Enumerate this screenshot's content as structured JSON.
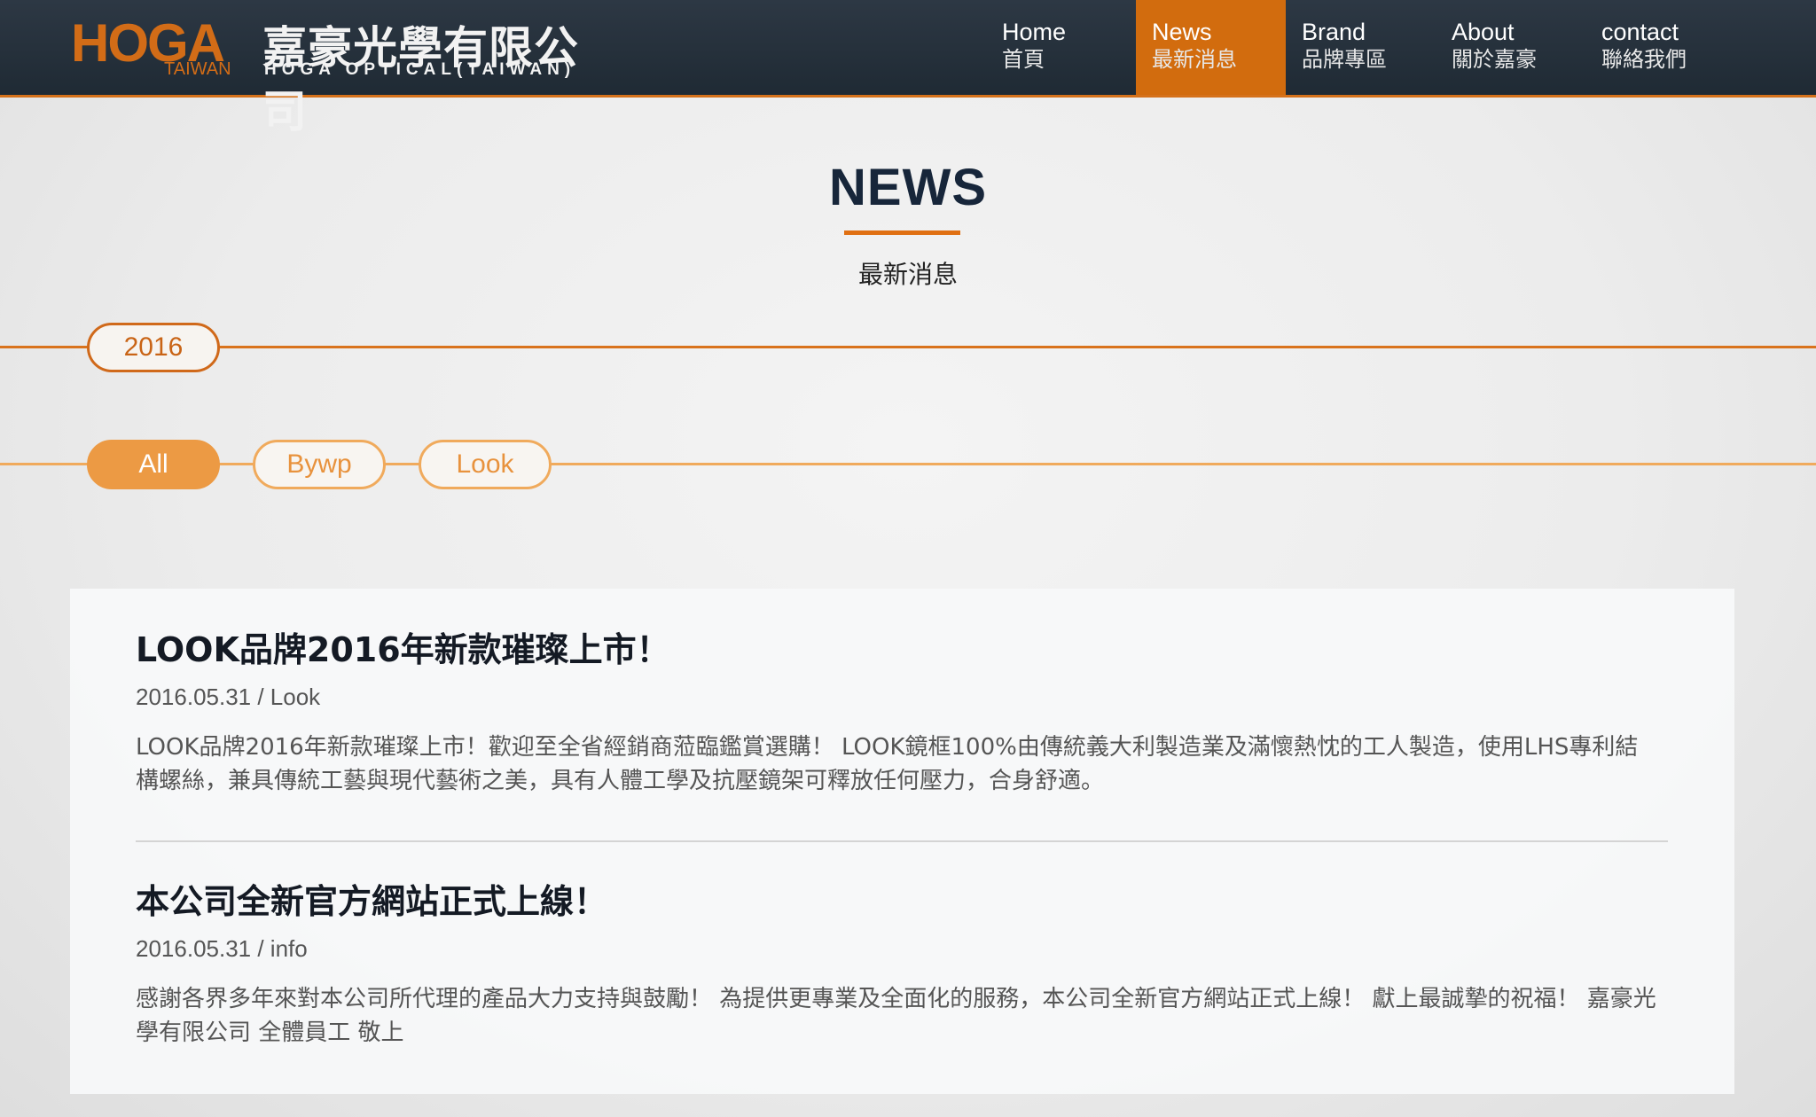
{
  "header": {
    "logo": {
      "brand": "HOGA",
      "region": "TAIWAN",
      "company_cn": "嘉豪光學有限公司",
      "company_en": "HOGA OPTICAL(TAIWAN)"
    },
    "nav": [
      {
        "en": "Home",
        "cn": "首頁"
      },
      {
        "en": "News",
        "cn": "最新消息"
      },
      {
        "en": "Brand",
        "cn": "品牌專區"
      },
      {
        "en": "About",
        "cn": "關於嘉豪"
      },
      {
        "en": "contact",
        "cn": "聯絡我們"
      }
    ],
    "active_nav": "News"
  },
  "page": {
    "title": "NEWS",
    "subtitle": "最新消息"
  },
  "timeline": {
    "year": "2016",
    "filters": [
      "All",
      "Bywp",
      "Look"
    ],
    "active_filter": "All"
  },
  "articles": [
    {
      "title": "LOOK品牌2016年新款璀璨上市！",
      "date": "2016.05.31",
      "category": "Look",
      "meta": "2016.05.31 / Look",
      "body": "LOOK品牌2016年新款璀璨上市！歡迎至全省經銷商蒞臨鑑賞選購！ LOOK鏡框100%由傳統義大利製造業及滿懷熱忱的工人製造，使用LHS專利結構螺絲，兼具傳統工藝與現代藝術之美，具有人體工學及抗壓鏡架可釋放任何壓力，合身舒適。"
    },
    {
      "title": "本公司全新官方網站正式上線！",
      "date": "2016.05.31",
      "category": "info",
      "meta": "2016.05.31 / info",
      "body": "感謝各界多年來對本公司所代理的產品大力支持與鼓勵！ 為提供更專業及全面化的服務，本公司全新官方網站正式上線！ 獻上最誠摯的祝福！ 嘉豪光學有限公司 全體員工 敬上"
    }
  ],
  "colors": {
    "header_bg": "#27323d",
    "accent": "#d26c0e",
    "accent_light": "#ec9a44",
    "title_text": "#17263a"
  }
}
